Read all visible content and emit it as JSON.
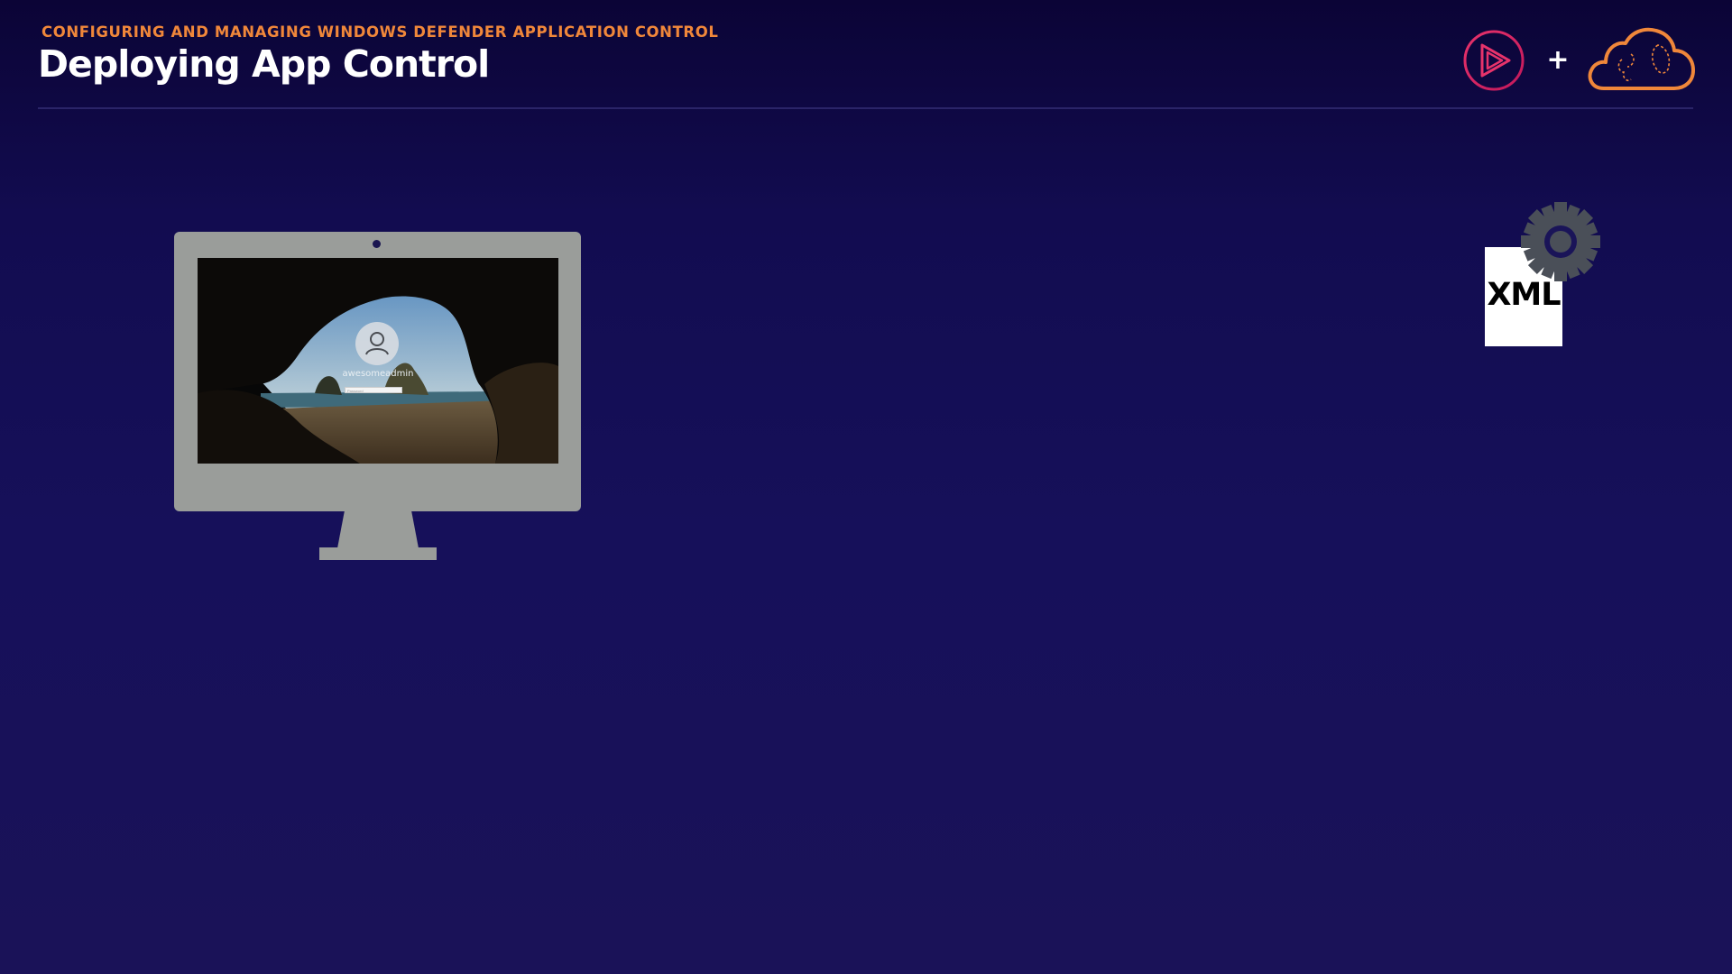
{
  "header": {
    "kicker": "CONFIGURING AND MANAGING WINDOWS DEFENDER APPLICATION CONTROL",
    "title": "Deploying App Control"
  },
  "logos": {
    "left": "pluralsight-play-icon",
    "plus": "+",
    "right": "cloud-brain-icon"
  },
  "monitor": {
    "login_username": "awesomeadmin",
    "password_placeholder": "Password"
  },
  "policy_file": {
    "label": "XML",
    "icon": "gear-icon"
  },
  "colors": {
    "accent_orange": "#f0873a",
    "background_top": "#0b0436",
    "background_bottom": "#1a1258",
    "monitor_gray": "#9a9d9a",
    "gear_gray": "#4a4f58"
  }
}
